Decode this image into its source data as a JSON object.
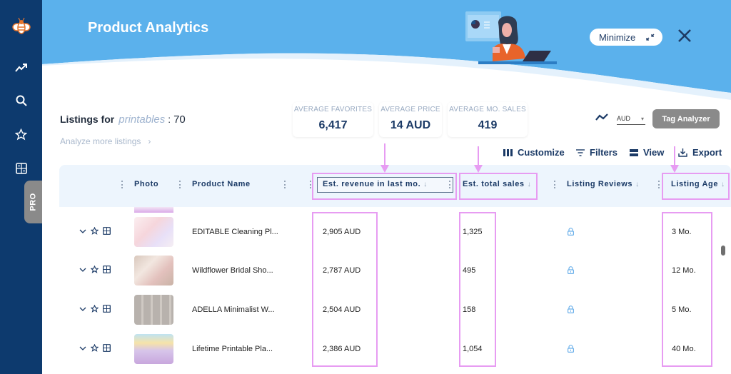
{
  "app": {
    "title": "Product Analytics",
    "minimize_label": "Minimize",
    "colors": {
      "sidebar": "#0d3a6e",
      "header": "#5bb1ec",
      "brand_text": "#1b3a66",
      "annotation": "#e79cf2",
      "button_gray": "#8a8a8a"
    }
  },
  "sidebar": {
    "items": [
      {
        "icon": "bee-logo-icon"
      },
      {
        "icon": "trend-icon"
      },
      {
        "icon": "search-icon"
      },
      {
        "icon": "star-icon"
      },
      {
        "icon": "calculator-icon"
      }
    ],
    "pro_label": "PRO"
  },
  "listings": {
    "prefix": "Listings for",
    "keyword": "printables",
    "separator": ":",
    "count": "70",
    "analyze_more": "Analyze more listings",
    "analyze_more_icon": "chevron-right-icon"
  },
  "stats": [
    {
      "label": "AVERAGE FAVORITES",
      "value": "6,417"
    },
    {
      "label": "AVERAGE PRICE",
      "value": "14 AUD"
    },
    {
      "label": "AVERAGE MO. SALES",
      "value": "419"
    }
  ],
  "controls": {
    "currency": "AUD",
    "tag_analyzer": "Tag Analyzer"
  },
  "toolbar": {
    "customize": "Customize",
    "filters": "Filters",
    "view": "View",
    "export": "Export"
  },
  "table": {
    "columns": [
      {
        "label": "Photo",
        "sortable": false
      },
      {
        "label": "Product Name",
        "sortable": false
      },
      {
        "label": "Est. revenue in last mo.",
        "sortable": true,
        "sort_icon": "↓"
      },
      {
        "label": "Est. total sales",
        "sortable": true,
        "sort_icon": "↓"
      },
      {
        "label": "Listing Reviews",
        "sortable": true,
        "sort_icon": "↓"
      },
      {
        "label": "Listing Age",
        "sortable": true,
        "sort_icon": "↓"
      }
    ],
    "rows": [
      {
        "name": "EDITABLE Cleaning Pl...",
        "revenue": "2,905 AUD",
        "sales": "1,325",
        "reviews": "locked",
        "age": "3 Mo."
      },
      {
        "name": "Wildflower Bridal Sho...",
        "revenue": "2,787 AUD",
        "sales": "495",
        "reviews": "locked",
        "age": "12 Mo."
      },
      {
        "name": "ADELLA Minimalist W...",
        "revenue": "2,504 AUD",
        "sales": "158",
        "reviews": "locked",
        "age": "5 Mo."
      },
      {
        "name": "Lifetime Printable Pla...",
        "revenue": "2,386 AUD",
        "sales": "1,054",
        "reviews": "locked",
        "age": "40 Mo."
      }
    ]
  }
}
